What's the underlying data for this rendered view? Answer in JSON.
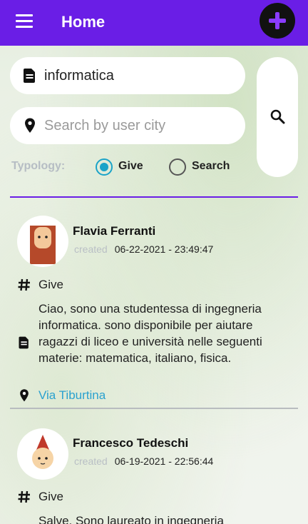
{
  "header": {
    "title": "Home",
    "menu_icon": "hamburger-menu-icon",
    "add_icon": "plus-circle-icon",
    "bar_color": "#6a1ee6"
  },
  "search": {
    "query_value": "informatica",
    "city_placeholder": "Search by user city",
    "search_icon": "magnifier-icon"
  },
  "typology": {
    "label": "Typology:",
    "options": [
      {
        "label": "Give",
        "selected": true
      },
      {
        "label": "Search",
        "selected": false
      }
    ],
    "accent_color": "#1aa3c8"
  },
  "posts": [
    {
      "author": "Flavia Ferranti",
      "created_label": "created",
      "date": "06-22-2021",
      "time": "23:49:47",
      "typology": "Give",
      "description": "Ciao, sono una studentessa di ingegneria informatica. sono disponibile per aiutare ragazzi di liceo e università nelle seguenti materie: matematica, italiano, fisica.",
      "street": "Via Tiburtina"
    },
    {
      "author": "Francesco Tedeschi",
      "created_label": "created",
      "date": "06-19-2021",
      "time": "22:56:44",
      "typology": "Give",
      "description": "Salve, Sono laureato in ingegneria"
    }
  ],
  "link_color": "#2aa1cf"
}
